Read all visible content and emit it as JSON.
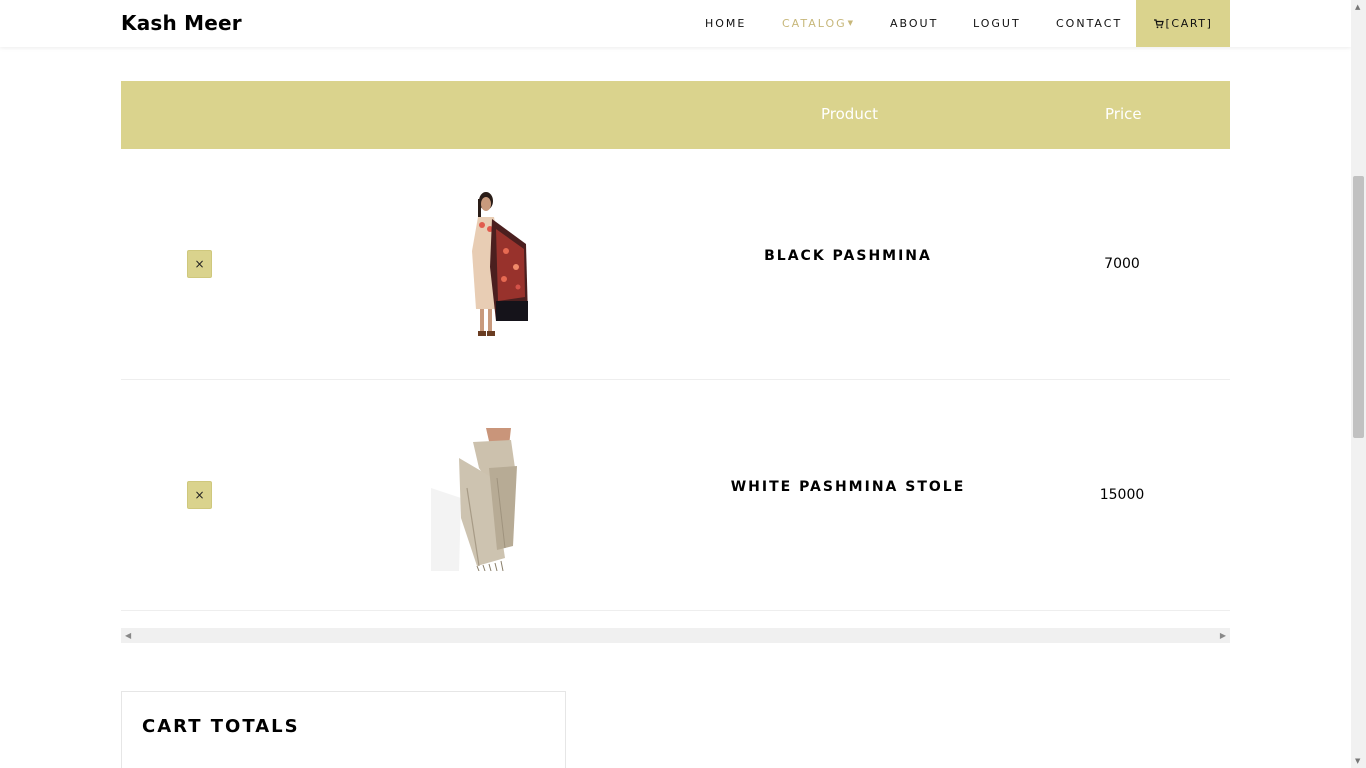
{
  "brand": "Kash Meer",
  "nav": {
    "home": "HOME",
    "catalog": "CATALOG",
    "about": "ABOUT",
    "logout": "LOGUT",
    "contact": "CONTACT",
    "cart": "[CART]"
  },
  "table": {
    "headers": {
      "product": "Product",
      "price": "Price"
    },
    "rows": [
      {
        "remove": "×",
        "name": "BLACK PASHMINA",
        "price": "7000"
      },
      {
        "remove": "×",
        "name": "WHITE PASHMINA STOLE",
        "price": "15000"
      }
    ]
  },
  "totals": {
    "title": "CART TOTALS"
  },
  "colors": {
    "accent": "#dad38d",
    "catalog_active": "#c7b77a"
  },
  "icons": {
    "cart": "shopping-cart-icon",
    "close": "close-icon"
  }
}
